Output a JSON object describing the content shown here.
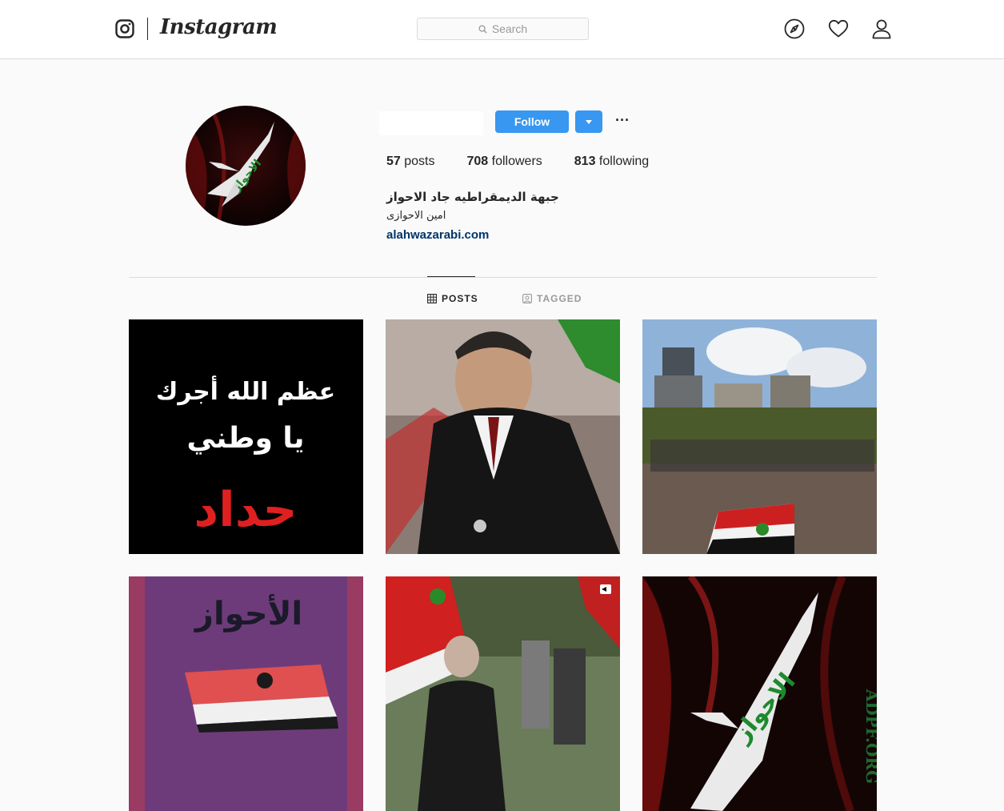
{
  "nav": {
    "wordmark": "Instagram",
    "search_placeholder": "Search",
    "icons": [
      "instagram-camera-icon",
      "search-icon",
      "explore-compass-icon",
      "activity-heart-icon",
      "profile-user-icon"
    ]
  },
  "profile": {
    "follow_label": "Follow",
    "more_label": "···",
    "stats": {
      "posts_count": "57",
      "posts_label": " posts",
      "followers_count": "708",
      "followers_label": " followers",
      "following_count": "813",
      "following_label": " following"
    },
    "bio": {
      "full_name": "جبهة الديمقراطيه جاد الاحواز",
      "line": "امين الاحوازى",
      "link": "alahwazarabi.com"
    },
    "avatar_text": "الاحواز"
  },
  "tabs": [
    {
      "label": "POSTS",
      "active": true,
      "icon": "grid-icon"
    },
    {
      "label": "TAGGED",
      "active": false,
      "icon": "tagged-icon"
    }
  ],
  "posts": {
    "post1": {
      "line1": "عظم الله أجرك",
      "line2": "يا وطني",
      "line3": "حداد"
    },
    "post4": {
      "title": "الأحواز"
    },
    "post5": {
      "badge_icon": "video-icon"
    },
    "post6": {
      "text": "الاحواز",
      "side_text": "ADPF.ORG"
    }
  },
  "colors": {
    "accent": "#3897f0",
    "link": "#003569",
    "border": "#dbdbdb",
    "background": "#fafafa"
  }
}
